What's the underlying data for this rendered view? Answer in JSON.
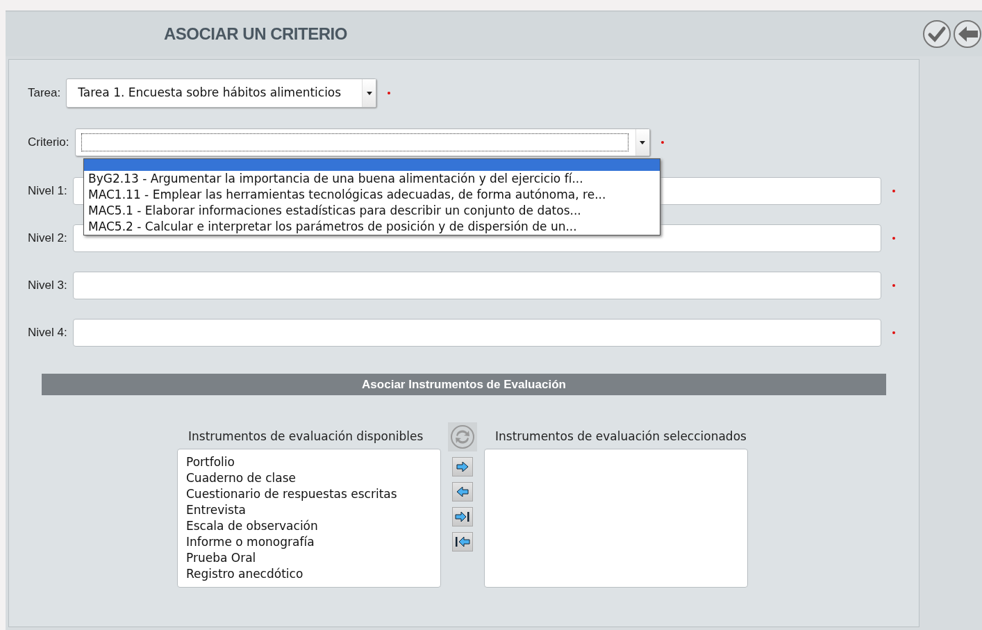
{
  "header": {
    "title": "ASOCIAR UN CRITERIO"
  },
  "tarea": {
    "label": "Tarea:",
    "value": "Tarea 1. Encuesta sobre hábitos alimenticios",
    "required": true
  },
  "criterio": {
    "label": "Criterio:",
    "value_focused": true,
    "required": true,
    "expanded": true,
    "blank_option_highlighted": true,
    "options": [
      {
        "text": "ByG2.13 - Argumentar la importancia de una buena alimentación y del ejercicio fí...",
        "selected": false
      },
      {
        "text": "MAC1.11 - Emplear las herramientas tecnológicas adecuadas, de forma autónoma, re...",
        "selected": false
      },
      {
        "text": "MAC5.1 - Elaborar informaciones estadísticas para describir un conjunto de datos...",
        "selected": false
      },
      {
        "text": "MAC5.2 - Calcular e interpretar los parámetros de posición y de dispersión de un...",
        "selected": false
      }
    ]
  },
  "niveles": [
    {
      "label": "Nivel 1:",
      "required": true
    },
    {
      "label": "Nivel 2:",
      "required": true
    },
    {
      "label": "Nivel 3:",
      "required": true
    },
    {
      "label": "Nivel 4:",
      "required": true
    }
  ],
  "section": {
    "title": "Asociar Instrumentos de Evaluación"
  },
  "available": {
    "label": "Instrumentos de evaluación disponibles",
    "items": [
      {
        "text": "Portfolio",
        "selected": false
      },
      {
        "text": "Cuaderno de clase",
        "selected": false
      },
      {
        "text": "Cuestionario de respuestas escritas",
        "selected": false
      },
      {
        "text": "Entrevista",
        "selected": false
      },
      {
        "text": "Escala de observación",
        "selected": false
      },
      {
        "text": "Informe o monografía",
        "selected": false
      },
      {
        "text": "Prueba Oral",
        "selected": false
      },
      {
        "text": "Registro anecdótico",
        "selected": false
      }
    ]
  },
  "selected_list": {
    "label": "Instrumentos de evaluación seleccionados"
  },
  "transfer_buttons": [
    {
      "kind": "reset"
    },
    {
      "kind": "add"
    },
    {
      "kind": "remove"
    },
    {
      "kind": "add_all"
    },
    {
      "kind": "remove_all"
    }
  ]
}
